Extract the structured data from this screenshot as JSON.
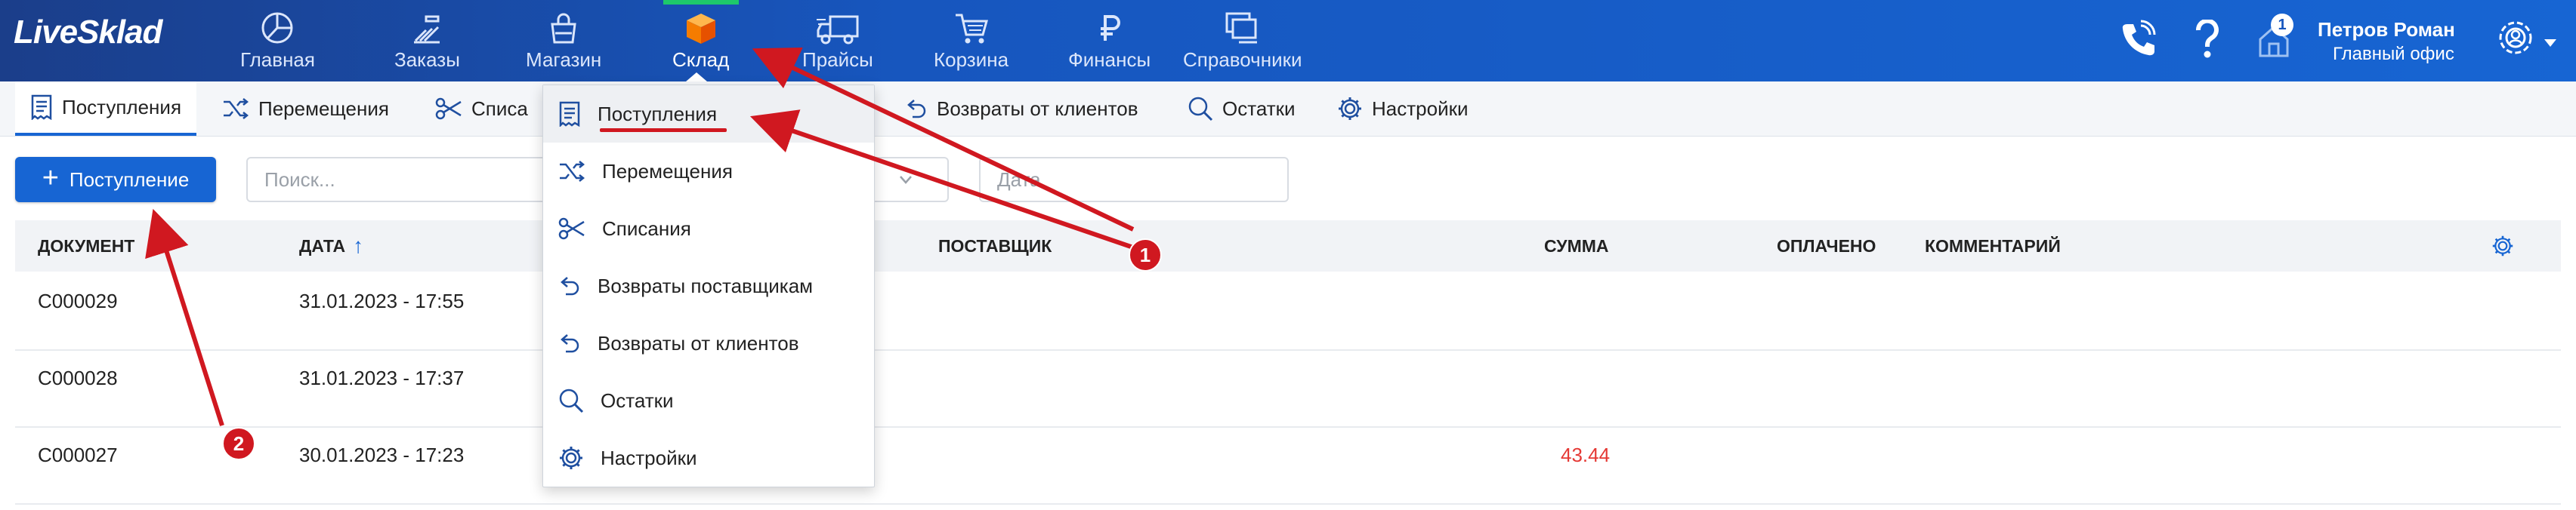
{
  "app": {
    "logo": "LiveSklad"
  },
  "nav": [
    {
      "label": "Главная",
      "icon": "dashboard-icon"
    },
    {
      "label": "Заказы",
      "icon": "orders-icon"
    },
    {
      "label": "Магазин",
      "icon": "shop-bag-icon"
    },
    {
      "label": "Склад",
      "icon": "warehouse-box-icon",
      "active": true
    },
    {
      "label": "Прайсы",
      "icon": "truck-icon"
    },
    {
      "label": "Корзина",
      "icon": "cart-icon"
    },
    {
      "label": "Финансы",
      "icon": "ruble-icon"
    },
    {
      "label": "Справочники",
      "icon": "directory-icon"
    }
  ],
  "header": {
    "notification_count": "1",
    "user_name": "Петров Роман",
    "user_office": "Главный офис"
  },
  "subnav": {
    "receipts": "Поступления",
    "transfers": "Перемещения",
    "writeoffs": "Списа",
    "client_returns": "Возвраты от клиентов",
    "stock": "Остатки",
    "settings": "Настройки"
  },
  "toolbar": {
    "add_label": "Поступление",
    "search_placeholder": "Поиск...",
    "date_placeholder": "Дата"
  },
  "table": {
    "columns": {
      "document": "ДОКУМЕНТ",
      "date": "ДАТА",
      "date_sort": "↑",
      "supplier": "ПОСТАВЩИК",
      "sum": "СУММА",
      "paid": "ОПЛАЧЕНО",
      "comment": "КОММЕНТАРИЙ"
    },
    "rows": [
      {
        "doc": "C000029",
        "date": "31.01.2023 - 17:55",
        "sum": ""
      },
      {
        "doc": "C000028",
        "date": "31.01.2023 - 17:37",
        "sum": ""
      },
      {
        "doc": "C000027",
        "date": "30.01.2023 - 17:23",
        "sum": "43.44"
      }
    ]
  },
  "dropdown": [
    {
      "label": "Поступления",
      "icon": "receipt-icon",
      "active": true
    },
    {
      "label": "Перемещения",
      "icon": "shuffle-icon"
    },
    {
      "label": "Списания",
      "icon": "scissors-icon"
    },
    {
      "label": "Возвраты поставщикам",
      "icon": "return-arrow-icon"
    },
    {
      "label": "Возвраты от клиентов",
      "icon": "return-arrow-icon"
    },
    {
      "label": "Остатки",
      "icon": "search-icon"
    },
    {
      "label": "Настройки",
      "icon": "gear-icon"
    }
  ],
  "annotations": {
    "badge1": "1",
    "badge2": "2"
  },
  "colors": {
    "topbar": "#1756be",
    "accent": "#1765d3",
    "annotation_red": "#d01820",
    "amount_red": "#e53935"
  }
}
